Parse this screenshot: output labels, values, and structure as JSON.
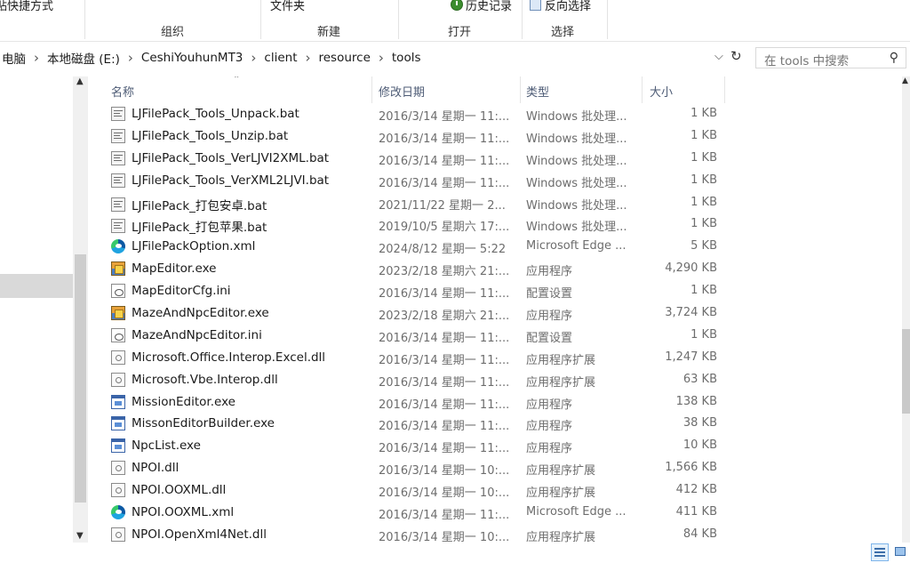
{
  "ribbon": {
    "fragments": {
      "left": "粘贴快捷方式",
      "folder": "文件夹",
      "history": "历史记录",
      "select": "反向选择"
    },
    "groups": {
      "organize": "组织",
      "new": "新建",
      "open": "打开",
      "select": "选择"
    }
  },
  "address": {
    "crumbs": [
      "电脑",
      "本地磁盘 (E:)",
      "CeshiYouhunMT3",
      "client",
      "resource",
      "tools"
    ],
    "separator": "›",
    "dropdown_icon": "chevron-down-icon",
    "refresh_icon": "refresh-icon"
  },
  "search": {
    "placeholder": "在 tools 中搜索",
    "icon": "search-icon"
  },
  "columns": {
    "name": "名称",
    "date": "修改日期",
    "type": "类型",
    "size": "大小"
  },
  "files": [
    {
      "name": "LJFilePack_Tools_Unpack.bat",
      "date": "2016/3/14 星期一 11:...",
      "type": "Windows 批处理...",
      "size": "1 KB",
      "icon": "bat"
    },
    {
      "name": "LJFilePack_Tools_Unzip.bat",
      "date": "2016/3/14 星期一 11:...",
      "type": "Windows 批处理...",
      "size": "1 KB",
      "icon": "bat"
    },
    {
      "name": "LJFilePack_Tools_VerLJVI2XML.bat",
      "date": "2016/3/14 星期一 11:...",
      "type": "Windows 批处理...",
      "size": "1 KB",
      "icon": "bat"
    },
    {
      "name": "LJFilePack_Tools_VerXML2LJVI.bat",
      "date": "2016/3/14 星期一 11:...",
      "type": "Windows 批处理...",
      "size": "1 KB",
      "icon": "bat"
    },
    {
      "name": "LJFilePack_打包安卓.bat",
      "date": "2021/11/22 星期一 2...",
      "type": "Windows 批处理...",
      "size": "1 KB",
      "icon": "bat"
    },
    {
      "name": "LJFilePack_打包苹果.bat",
      "date": "2019/10/5 星期六 17:...",
      "type": "Windows 批处理...",
      "size": "1 KB",
      "icon": "bat"
    },
    {
      "name": "LJFilePackOption.xml",
      "date": "2024/8/12 星期一 5:22",
      "type": "Microsoft Edge ...",
      "size": "5 KB",
      "icon": "edge"
    },
    {
      "name": "MapEditor.exe",
      "date": "2023/2/18 星期六 21:...",
      "type": "应用程序",
      "size": "4,290 KB",
      "icon": "exe-color"
    },
    {
      "name": "MapEditorCfg.ini",
      "date": "2016/3/14 星期一 11:...",
      "type": "配置设置",
      "size": "1 KB",
      "icon": "ini"
    },
    {
      "name": "MazeAndNpcEditor.exe",
      "date": "2023/2/18 星期六 21:...",
      "type": "应用程序",
      "size": "3,724 KB",
      "icon": "exe-color"
    },
    {
      "name": "MazeAndNpcEditor.ini",
      "date": "2016/3/14 星期一 11:...",
      "type": "配置设置",
      "size": "1 KB",
      "icon": "ini"
    },
    {
      "name": "Microsoft.Office.Interop.Excel.dll",
      "date": "2016/3/14 星期一 11:...",
      "type": "应用程序扩展",
      "size": "1,247 KB",
      "icon": "dll"
    },
    {
      "name": "Microsoft.Vbe.Interop.dll",
      "date": "2016/3/14 星期一 11:...",
      "type": "应用程序扩展",
      "size": "63 KB",
      "icon": "dll"
    },
    {
      "name": "MissionEditor.exe",
      "date": "2016/3/14 星期一 11:...",
      "type": "应用程序",
      "size": "138 KB",
      "icon": "app"
    },
    {
      "name": "MissonEditorBuilder.exe",
      "date": "2016/3/14 星期一 11:...",
      "type": "应用程序",
      "size": "38 KB",
      "icon": "app"
    },
    {
      "name": "NpcList.exe",
      "date": "2016/3/14 星期一 11:...",
      "type": "应用程序",
      "size": "10 KB",
      "icon": "app"
    },
    {
      "name": "NPOI.dll",
      "date": "2016/3/14 星期一 10:...",
      "type": "应用程序扩展",
      "size": "1,566 KB",
      "icon": "dll"
    },
    {
      "name": "NPOI.OOXML.dll",
      "date": "2016/3/14 星期一 10:...",
      "type": "应用程序扩展",
      "size": "412 KB",
      "icon": "dll"
    },
    {
      "name": "NPOI.OOXML.xml",
      "date": "2016/3/14 星期一 11:...",
      "type": "Microsoft Edge ...",
      "size": "411 KB",
      "icon": "edge"
    },
    {
      "name": "NPOI.OpenXml4Net.dll",
      "date": "2016/3/14 星期一 10:...",
      "type": "应用程序扩展",
      "size": "84 KB",
      "icon": "dll"
    }
  ],
  "view_buttons": {
    "details_icon": "details-view-icon",
    "thumbnails_icon": "large-icons-view-icon"
  }
}
